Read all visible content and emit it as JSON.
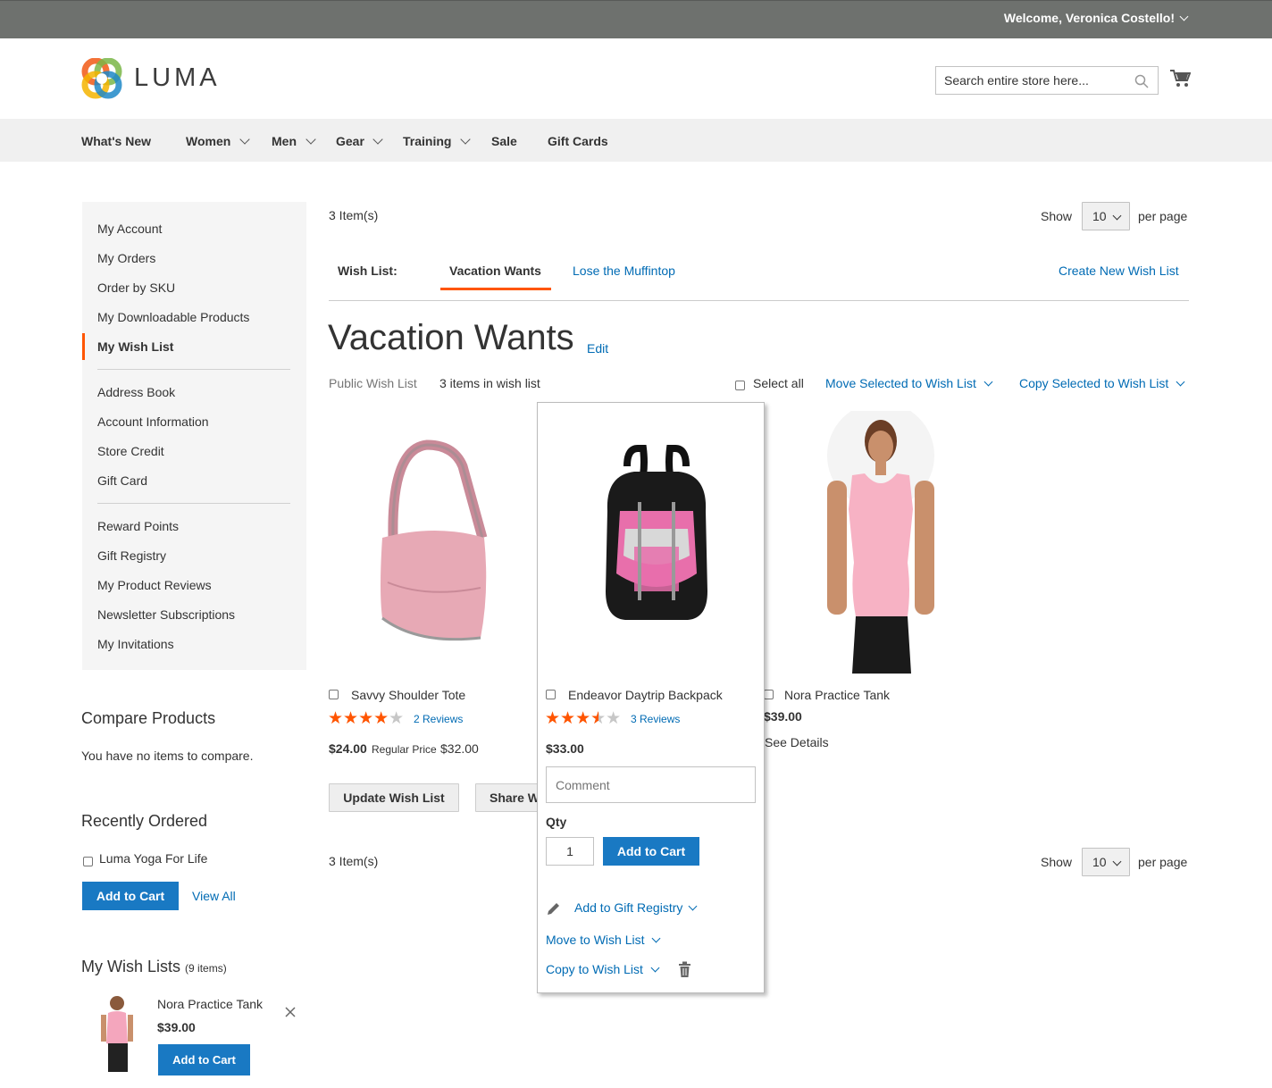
{
  "topbar": {
    "welcome": "Welcome, Veronica Costello!"
  },
  "header": {
    "logo_text": "LUMA",
    "search_placeholder": "Search entire store here..."
  },
  "nav": [
    "What's New",
    "Women",
    "Men",
    "Gear",
    "Training",
    "Sale",
    "Gift Cards"
  ],
  "sidebar": {
    "group1": [
      "My Account",
      "My Orders",
      "Order by SKU",
      "My Downloadable Products",
      "My Wish List"
    ],
    "group2": [
      "Address Book",
      "Account Information",
      "Store Credit",
      "Gift Card"
    ],
    "group3": [
      "Reward Points",
      "Gift Registry",
      "My Product Reviews",
      "Newsletter Subscriptions",
      "My Invitations"
    ],
    "active": "My Wish List"
  },
  "compare": {
    "title": "Compare Products",
    "empty": "You have no items to compare."
  },
  "recent": {
    "title": "Recently Ordered",
    "item": "Luma Yoga For Life",
    "add_to_cart": "Add to Cart",
    "view_all": "View All"
  },
  "my_wishlists": {
    "title": "My Wish Lists",
    "count": "(9 items)",
    "item_name": "Nora Practice Tank",
    "item_price": "$39.00",
    "add_to_cart": "Add to Cart"
  },
  "toolbar": {
    "items_count": "3 Item(s)",
    "show": "Show",
    "per_page_value": "10",
    "per_page": "per page"
  },
  "tabs": {
    "label": "Wish List:",
    "active": "Vacation Wants",
    "other": "Lose the Muffintop",
    "create": "Create New Wish List"
  },
  "wishlist": {
    "title": "Vacation Wants",
    "edit": "Edit",
    "visibility": "Public Wish List",
    "count_text": "3 items in wish list",
    "select_all": "Select all",
    "move_selected": "Move Selected to Wish List",
    "copy_selected": "Copy Selected to Wish List"
  },
  "products": [
    {
      "name": "Savvy Shoulder Tote",
      "rating": 4,
      "reviews": "2 Reviews",
      "price": "$24.00",
      "regular_label": "Regular Price",
      "regular_price": "$32.00"
    },
    {
      "name": "Endeavor Daytrip Backpack",
      "rating": 3.5,
      "reviews": "3 Reviews",
      "price": "$33.00",
      "comment_placeholder": "Comment",
      "qty_label": "Qty",
      "qty": "1",
      "add_to_cart": "Add to Cart",
      "gift_registry": "Add to Gift Registry",
      "move": "Move to Wish List",
      "copy": "Copy to Wish List"
    },
    {
      "name": "Nora Practice Tank",
      "price": "$39.00",
      "see_details": "See Details"
    }
  ],
  "actions": {
    "update": "Update Wish List",
    "share": "Share Wish List"
  }
}
